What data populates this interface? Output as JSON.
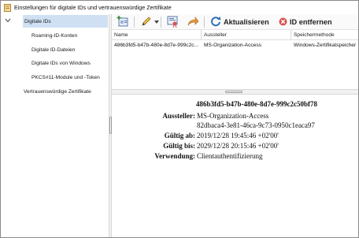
{
  "window": {
    "title": "Einstellungen für digitale IDs und vertrauenswürdige Zertifikate"
  },
  "sidebar": {
    "items": [
      {
        "label": "Digitale IDs",
        "selected": true,
        "expanded": true
      },
      {
        "label": "Roaming-ID-Konten"
      },
      {
        "label": "Digitale ID-Dateien"
      },
      {
        "label": "Digitale IDs von Windows"
      },
      {
        "label": "PKCS#11-Module und -Token"
      },
      {
        "label": "Vertrauenswürdige Zertifikate"
      }
    ]
  },
  "toolbar": {
    "add_id_icon": "add-id-icon",
    "sign_icon": "pen-icon",
    "certificate_icon": "certificate-icon",
    "export_icon": "arrow-export-icon",
    "refresh_label": "Aktualisieren",
    "remove_label": "ID entfernen"
  },
  "table": {
    "columns": [
      "Name",
      "Aussteller",
      "Speichermethode"
    ],
    "rows": [
      [
        "486b3fd5-b47b-480e-8d7e-999c2c...",
        "MS-Organization-Access",
        "Windows-Zertifikatspeicher"
      ]
    ]
  },
  "details": {
    "title": "486b3fd5-b47b-480e-8d7e-999c2c50bf78",
    "fields": [
      {
        "key": "Aussteller:",
        "value": "MS-Organization-Access"
      },
      {
        "key": "",
        "value": "82dbaca4-3e81-46ca-9c73-0950c1eaca97"
      },
      {
        "key": "Gültig ab:",
        "value": "2019/12/28 19:45:46 +02'00'"
      },
      {
        "key": "Gültig bis:",
        "value": "2029/12/28 20:15:46 +02'00'"
      },
      {
        "key": "Verwendung:",
        "value": "Clientauthentifizierung"
      }
    ]
  },
  "colors": {
    "selection": "#cfe0f3",
    "refresh_green": "#2f8a3a",
    "remove_red": "#d9534f"
  }
}
